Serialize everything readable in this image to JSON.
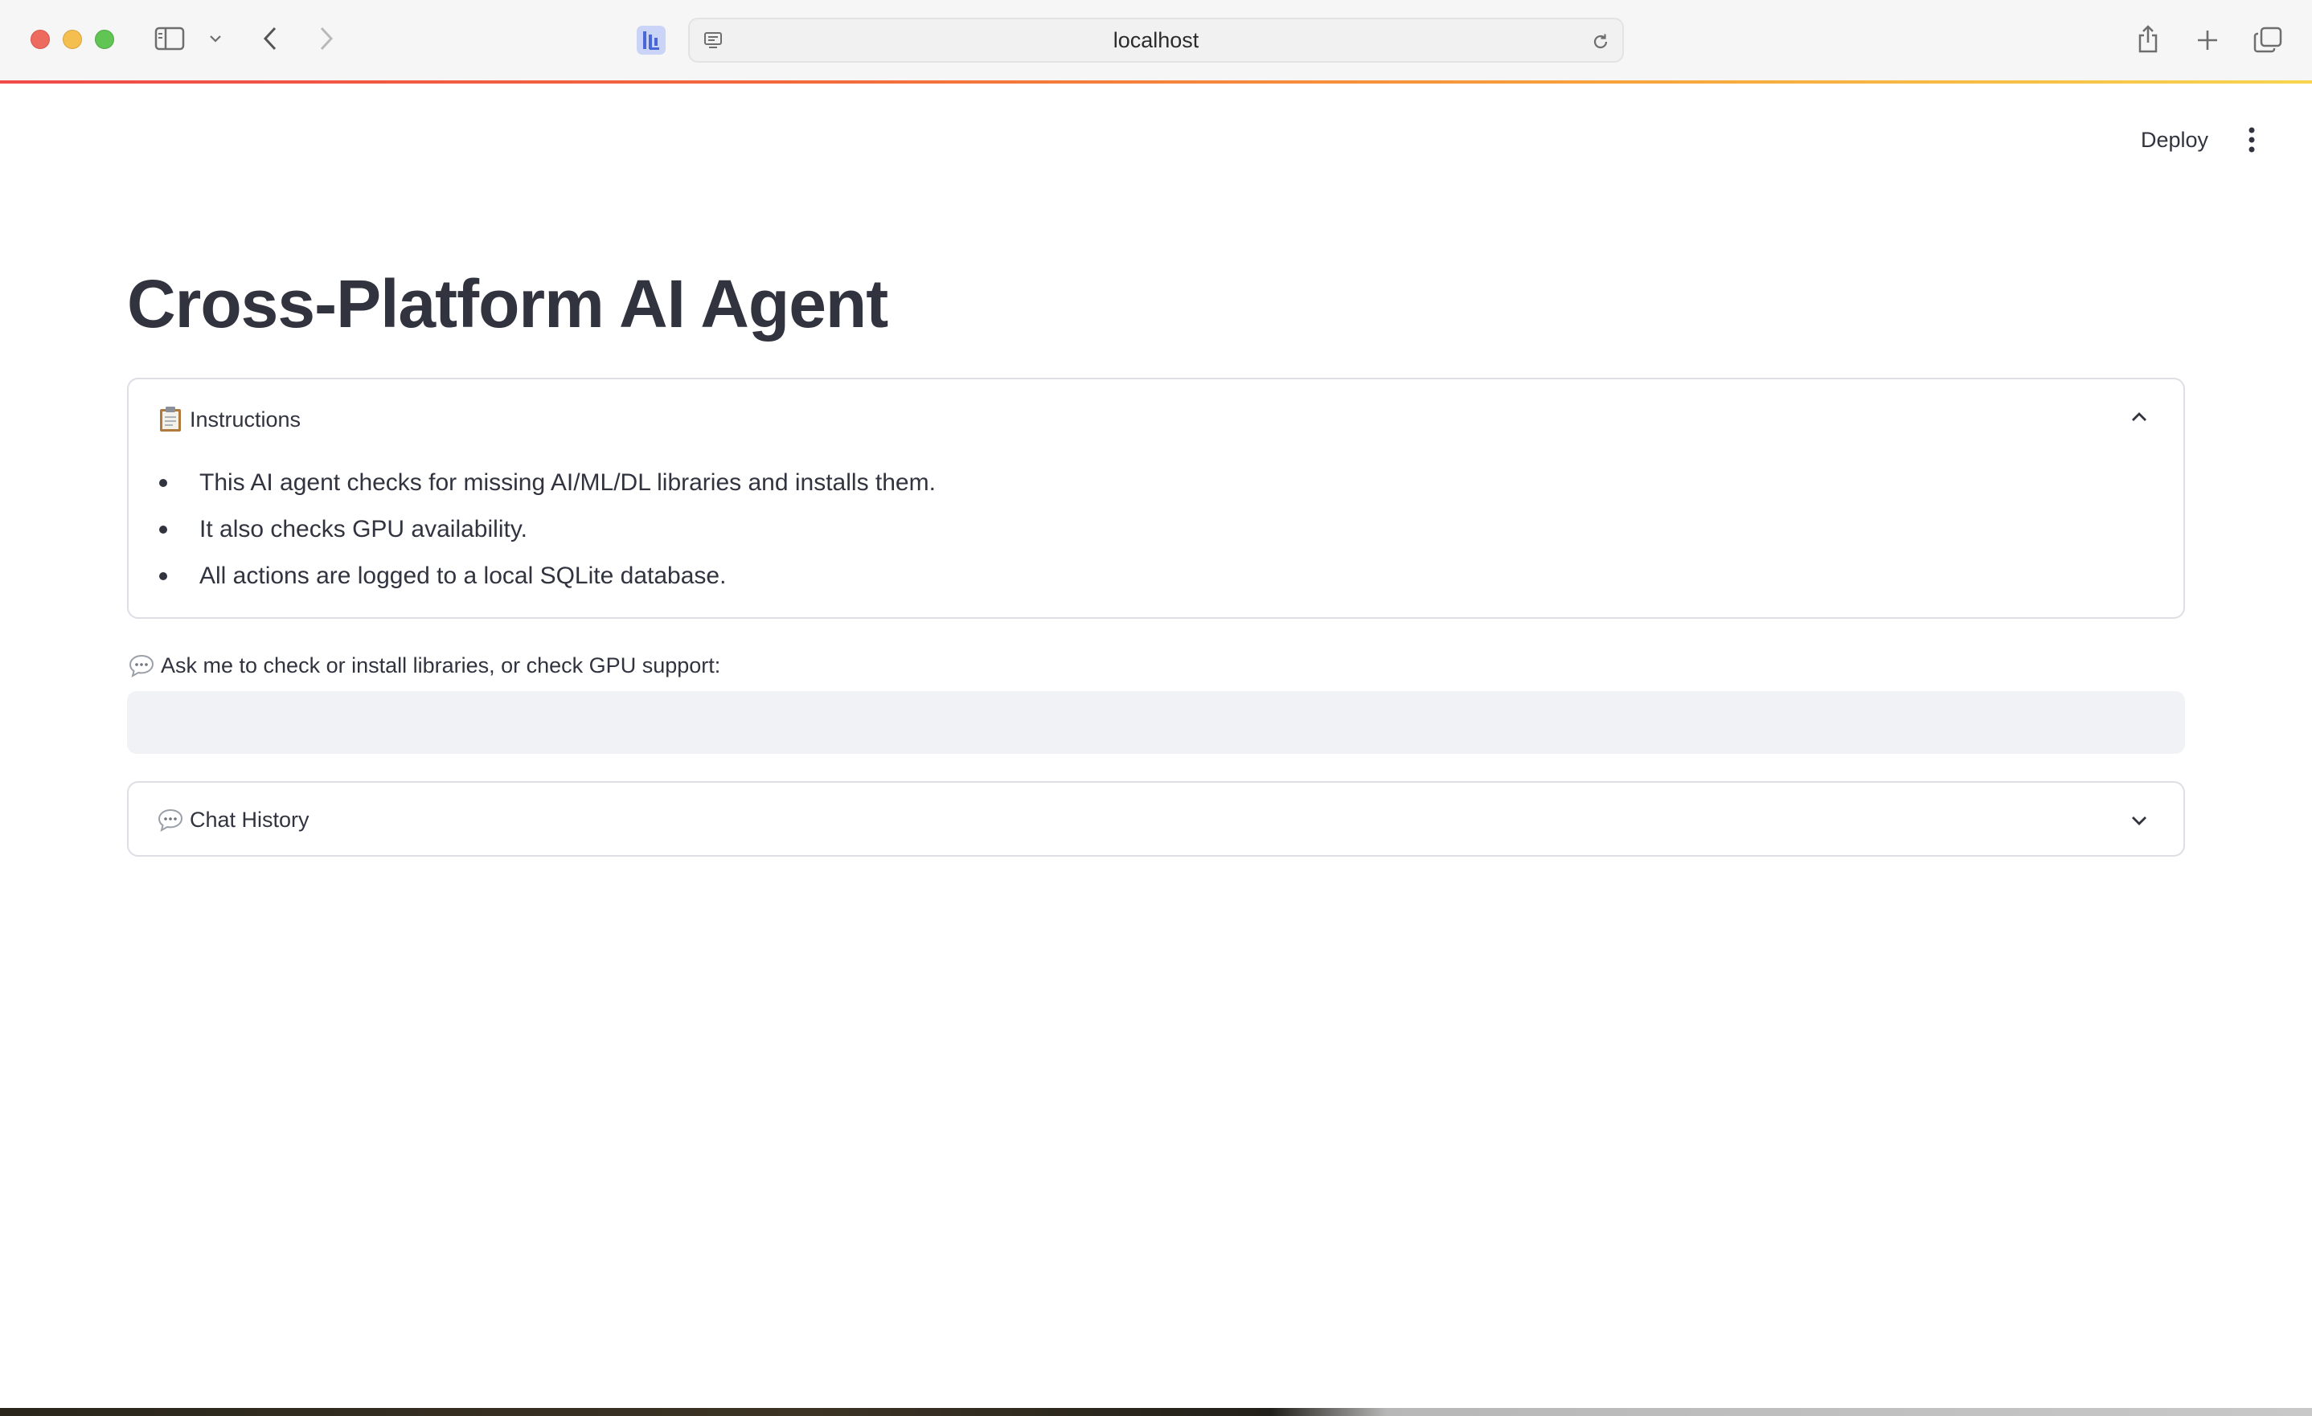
{
  "browser": {
    "address": "localhost"
  },
  "header": {
    "deploy_label": "Deploy"
  },
  "main": {
    "title": "Cross-Platform AI Agent",
    "instructions": {
      "label": "Instructions",
      "items": [
        "This AI agent checks for missing AI/ML/DL libraries and installs them.",
        "It also checks GPU availability.",
        "All actions are logged to a local SQLite database."
      ]
    },
    "input": {
      "label": "Ask me to check or install libraries, or check GPU support:",
      "value": ""
    },
    "chat_history": {
      "label": "Chat History"
    }
  },
  "colors": {
    "text": "#31333f",
    "input_bg": "#f0f2f6",
    "border": "#dedfe4"
  }
}
